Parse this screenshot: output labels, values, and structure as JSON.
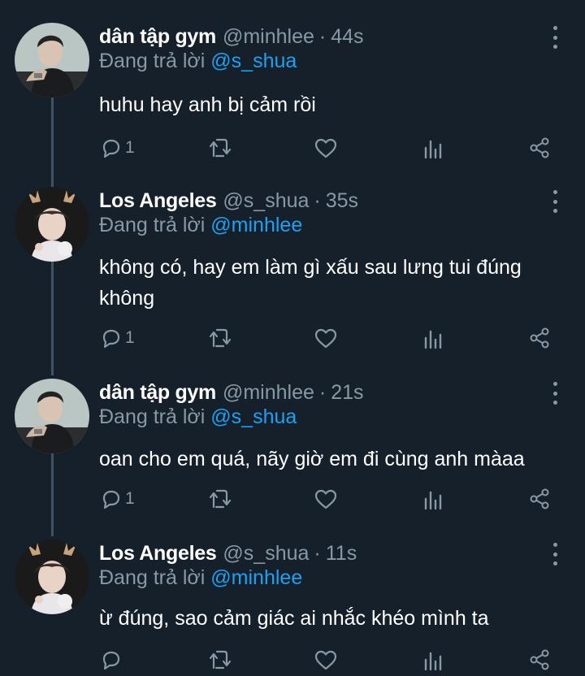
{
  "tweets": [
    {
      "name": "dân tập gym",
      "handle": "@minhlee",
      "time": "44s",
      "replying_prefix": "Đang trả lời",
      "replying_to": "@s_shua",
      "text": "huhu hay anh bị cảm rồi",
      "reply_count": "1",
      "avatar": "man-avatar"
    },
    {
      "name": "Los Angeles",
      "handle": "@s_shua",
      "time": "35s",
      "replying_prefix": "Đang trả lời",
      "replying_to": "@minhlee",
      "text": "không có, hay em làm gì xấu sau lưng tui đúng không",
      "reply_count": "1",
      "avatar": "deer-avatar"
    },
    {
      "name": "dân tập gym",
      "handle": "@minhlee",
      "time": "21s",
      "replying_prefix": "Đang trả lời",
      "replying_to": "@s_shua",
      "text": "oan cho em quá, nãy giờ em đi cùng anh màaa",
      "reply_count": "1",
      "avatar": "man-avatar"
    },
    {
      "name": "Los Angeles",
      "handle": "@s_shua",
      "time": "11s",
      "replying_prefix": "Đang trả lời",
      "replying_to": "@minhlee",
      "text": "ừ đúng, sao cảm giác ai nhắc khéo mình ta",
      "reply_count": "",
      "avatar": "deer-avatar"
    }
  ],
  "separator": "·",
  "colors": {
    "background": "#15202b",
    "secondary_text": "#8899a6",
    "mention": "#1da1f2",
    "thread_line": "#3d5466"
  },
  "icons": [
    "reply-icon",
    "retweet-icon",
    "like-icon",
    "analytics-icon",
    "share-icon",
    "more-icon"
  ]
}
